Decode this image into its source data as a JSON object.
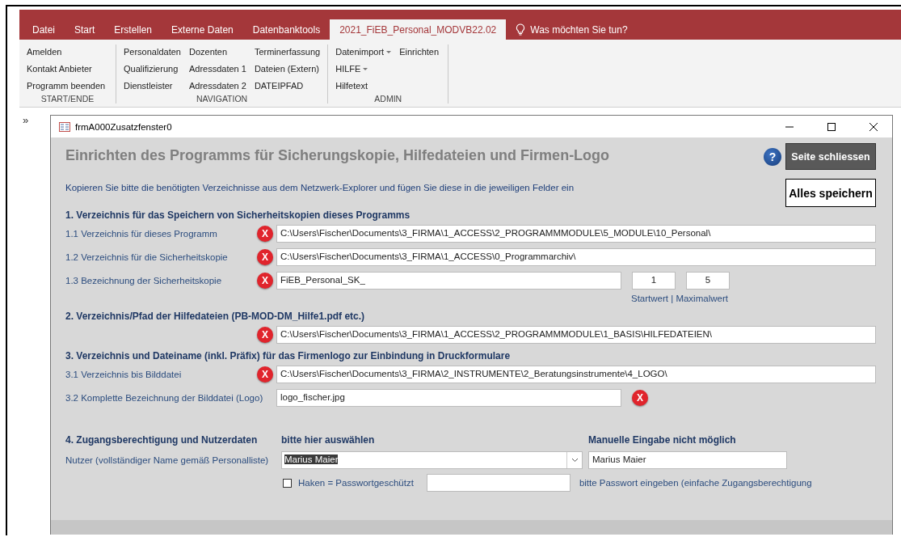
{
  "ribbon": {
    "tabs": [
      {
        "label": "Datei",
        "selected": false
      },
      {
        "label": "Start",
        "selected": false
      },
      {
        "label": "Erstellen",
        "selected": false
      },
      {
        "label": "Externe Daten",
        "selected": false
      },
      {
        "label": "Datenbanktools",
        "selected": false
      },
      {
        "label": "2021_FiEB_Personal_MODVB22.02",
        "selected": true
      }
    ],
    "tell_me": "Was möchten Sie tun?",
    "groups": [
      {
        "label": "START/ENDE",
        "columns": [
          [
            {
              "label": "Amelden",
              "dropdown": false
            },
            {
              "label": "Kontakt Anbieter",
              "dropdown": false
            },
            {
              "label": "Programm beenden",
              "dropdown": false
            }
          ]
        ]
      },
      {
        "label": "NAVIGATION",
        "columns": [
          [
            {
              "label": "Personaldaten",
              "dropdown": false
            },
            {
              "label": "Qualifizierung",
              "dropdown": false
            },
            {
              "label": "Dienstleister",
              "dropdown": false
            }
          ],
          [
            {
              "label": "Dozenten",
              "dropdown": false
            },
            {
              "label": "Adressdaten 1",
              "dropdown": false
            },
            {
              "label": "Adressdaten 2",
              "dropdown": false
            }
          ],
          [
            {
              "label": "Terminerfassung",
              "dropdown": false
            },
            {
              "label": "Dateien (Extern)",
              "dropdown": false
            },
            {
              "label": "DATEIPFAD",
              "dropdown": false
            }
          ]
        ]
      },
      {
        "label": "ADMIN",
        "columns": [
          [
            {
              "label": "Datenimport",
              "dropdown": true
            },
            {
              "label": "HILFE",
              "dropdown": true
            },
            {
              "label": "Hilfetext",
              "dropdown": false
            }
          ],
          [
            {
              "label": "Einrichten",
              "dropdown": false
            }
          ]
        ]
      }
    ]
  },
  "nav_pane_toggle": "»",
  "form": {
    "title": "frmA000Zusatzfenster0",
    "heading": "Einrichten des Programms für Sicherungskopie, Hilfedateien und Firmen-Logo",
    "intro": "Kopieren Sie bitte die benötigten Verzeichnisse aus dem Netzwerk-Explorer und fügen Sie diese in die jeweiligen Felder ein",
    "help_button": "?",
    "close_button": "Seite schliessen",
    "save_button": "Alles speichern",
    "sections": [
      {
        "heading": "1. Verzeichnis für das Speichern von Sicherheitskopien dieses Programms",
        "rows": [
          {
            "kind": "path",
            "label": "1.1 Verzeichnis für dieses Programm",
            "value": "C:\\Users\\Fischer\\Documents\\3_FIRMA\\1_ACCESS\\2_PROGRAMMMODULE\\5_MODULE\\10_Personal\\",
            "clear": {
              "label": "X"
            }
          },
          {
            "kind": "path",
            "label": "1.2 Verzeichnis für die Sicherheitskopie",
            "value": "C:\\Users\\Fischer\\Documents\\3_FIRMA\\1_ACCESS\\0_Programmarchiv\\",
            "clear": {
              "label": "X"
            }
          },
          {
            "kind": "counter",
            "label": "1.3 Bezeichnung der Sicherheitskopie",
            "value": "FiEB_Personal_SK_",
            "clear": {
              "label": "X"
            },
            "start": "1",
            "max": "5",
            "caption": "Startwert | Maximalwert"
          }
        ]
      },
      {
        "heading": "2. Verzeichnis/Pfad der Hilfedateien (PB-MOD-DM_Hilfe1.pdf etc.)",
        "rows": [
          {
            "kind": "path",
            "value": "C:\\Users\\Fischer\\Documents\\3_FIRMA\\1_ACCESS\\2_PROGRAMMMODULE\\1_BASIS\\HILFEDATEIEN\\",
            "clear": {
              "label": "X"
            }
          }
        ]
      },
      {
        "heading": "3. Verzeichnis und Dateiname (inkl. Präfix) für das Firmenlogo zur Einbindung in Druckformulare",
        "rows": [
          {
            "kind": "path",
            "label": "3.1 Verzeichnis bis Bilddatei",
            "value": "C:\\Users\\Fischer\\Documents\\3_FIRMA\\2_INSTRUMENTE\\2_Beratungsinstrumente\\4_LOGO\\",
            "clear": {
              "label": "X"
            }
          },
          {
            "kind": "short",
            "label": "3.2 Komplette Bezeichnung der Bilddatei (Logo)",
            "value": "logo_fischer.jpg",
            "clear": {
              "label": "X"
            }
          }
        ]
      }
    ],
    "access": {
      "heading": "4. Zugangsberechtigung und Nutzerdaten",
      "select_heading": "bitte hier auswählen",
      "manual_heading": "Manuelle Eingabe nicht möglich",
      "user_label": "Nutzer (vollständiger Name gemäß Personalliste)",
      "user_select": {
        "value": "Marius Maier",
        "value_highlighted": true
      },
      "user_display": "Marius Maier",
      "password_protected": {
        "label": "Haken = Passwortgeschützt",
        "checked": false
      },
      "password_hint": "bitte Passwort eingeben (einfache Zugangsberechtigung"
    }
  }
}
